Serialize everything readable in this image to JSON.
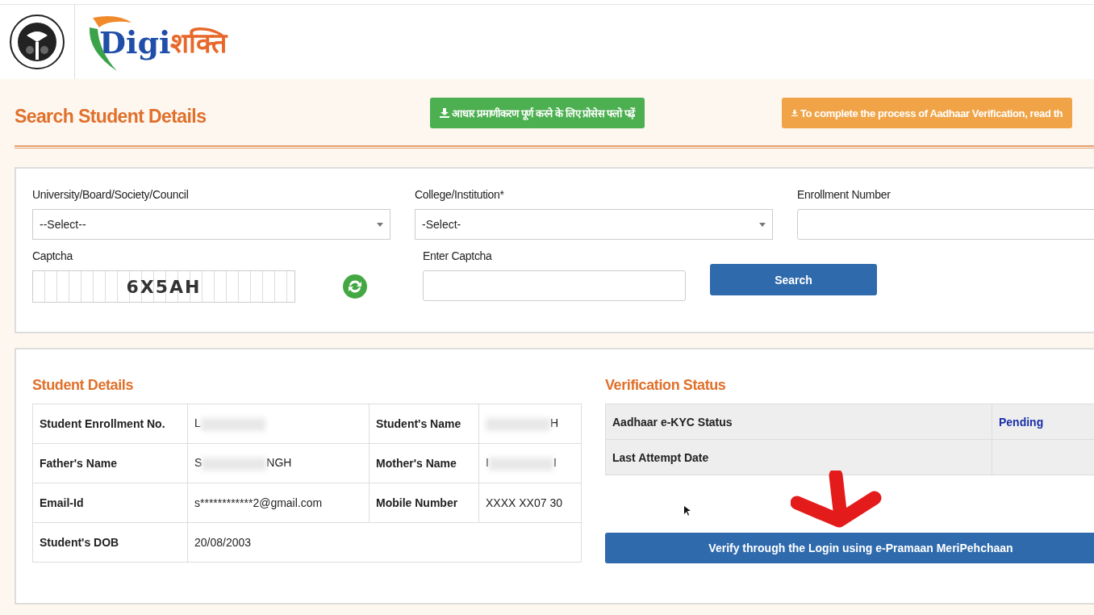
{
  "header": {
    "logo_text_latin": "Digi",
    "logo_text_devanagari": "शक्ति"
  },
  "page_title": "Search Student Details",
  "notice_buttons": [
    {
      "kind": "hindi",
      "label": "आधार प्रमाणीकरण पूर्ण करने के लिए प्रोसेस फ्लो पढ़ें"
    },
    {
      "kind": "english",
      "label": "To complete the process of Aadhaar Verification, read th"
    }
  ],
  "search_form": {
    "fields": [
      {
        "kind": "select",
        "label": "University/Board/Society/Council",
        "value": "--Select--"
      },
      {
        "kind": "select",
        "label": "College/Institution*",
        "value": "-Select-"
      },
      {
        "kind": "text",
        "label": "Enrollment Number"
      }
    ],
    "captcha": {
      "label": "Captcha",
      "code": "6X5AH"
    },
    "captcha_input": {
      "label": "Enter Captcha"
    },
    "search_button": "Search"
  },
  "student_details": {
    "title": "Student Details",
    "rows": [
      [
        {
          "label": "Student Enrollment No.",
          "value": "L",
          "redacted": true
        },
        {
          "label": "Student's Name",
          "value_end": "H",
          "redacted": true
        }
      ],
      [
        {
          "label": "Father's Name",
          "value": "S",
          "value_end": "NGH",
          "redacted": true
        },
        {
          "label": "Mother's Name",
          "value": "I",
          "value_end": "I",
          "redacted": true
        }
      ],
      [
        {
          "label": "Email-Id",
          "value": "s************2@gmail.com"
        },
        {
          "label": "Mobile Number",
          "value": "XXXX XX07 30"
        }
      ],
      [
        {
          "label": "Student's DOB",
          "value": "20/08/2003"
        }
      ]
    ]
  },
  "verification_status": {
    "title": "Verification Status",
    "rows": [
      {
        "label": "Aadhaar e-KYC Status",
        "value": "Pending"
      },
      {
        "label": "Last Attempt Date"
      }
    ],
    "verify_button": "Verify through the Login using e-Pramaan MeriPehchaan"
  }
}
